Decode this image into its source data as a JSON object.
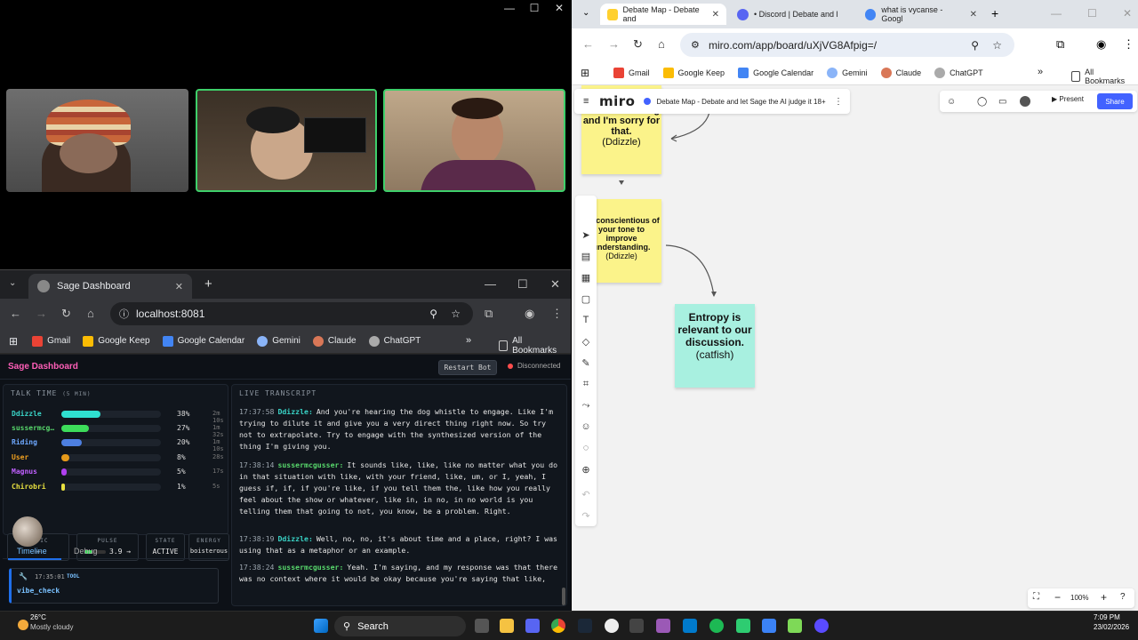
{
  "call": {
    "controls": [
      "—",
      "☐",
      "✕"
    ]
  },
  "sage_browser": {
    "tab_title": "Sage Dashboard",
    "url": "localhost:8081",
    "bookmarks": [
      "Gmail",
      "Google Keep",
      "Google Calendar",
      "Gemini",
      "Claude",
      "ChatGPT"
    ],
    "all_bookmarks": "All Bookmarks",
    "window_controls": [
      "—",
      "☐",
      "✕"
    ]
  },
  "sage": {
    "title": "Sage Dashboard",
    "restart_label": "Restart Bot",
    "status": "Disconnected",
    "talk_time_header": "TALK TIME",
    "talk_time_window": "(5 MIN)",
    "speakers": [
      {
        "name": "Ddizzle",
        "pct": "38%",
        "time": "2m 10s",
        "frac": 0.38,
        "color": "#39d3c6",
        "bar": "#2fe0d0"
      },
      {
        "name": "sussermcg…",
        "pct": "27%",
        "time": "1m 32s",
        "frac": 0.27,
        "color": "#57d66b",
        "bar": "#3ddc5a"
      },
      {
        "name": "Riding",
        "pct": "20%",
        "time": "1m 10s",
        "frac": 0.2,
        "color": "#6ea8ff",
        "bar": "#4d7fe0"
      },
      {
        "name": "User",
        "pct": "8%",
        "time": "28s",
        "frac": 0.08,
        "color": "#f0a020",
        "bar": "#e69a1a"
      },
      {
        "name": "Magnus",
        "pct": "5%",
        "time": "17s",
        "frac": 0.05,
        "color": "#c060ff",
        "bar": "#b040f0"
      },
      {
        "name": "Chirobri",
        "pct": "1%",
        "time": "5s",
        "frac": 0.01,
        "color": "#e8e040",
        "bar": "#e8e040"
      }
    ],
    "stats": [
      {
        "label": "TOPIC",
        "value": "–"
      },
      {
        "label": "PULSE",
        "value": "3.9 →"
      },
      {
        "label": "STATE",
        "value": "ACTIVE"
      },
      {
        "label": "ENERGY",
        "value": "boisterous"
      }
    ],
    "pulse_frac": 0.39,
    "tabs": {
      "timeline": "Timeline",
      "debug": "Debug"
    },
    "timeline_entry": {
      "time": "17:35:01",
      "kind": "TOOL",
      "name": "vibe_check"
    },
    "transcript_header": "LIVE TRANSCRIPT",
    "transcript": [
      {
        "time": "17:37:58",
        "speaker": "Ddizzle:",
        "color": "#39d3c6",
        "text": "And you're hearing the dog whistle to engage. Like I'm trying to dilute it and give you a very direct thing right now. So try not to extrapolate. Try to engage with the synthesized version of the thing I'm giving you."
      },
      {
        "time": "17:38:14",
        "speaker": "sussermcgusser:",
        "color": "#57d66b",
        "text": "It sounds like, like, like no matter what you do in that situation with like, with your friend, like, um, or I, yeah, I guess if, if, if you're like, if you tell them the, like how you really feel about the show or whatever, like in, in no, in no world is you telling them that going to not, you know, be a problem. Right."
      },
      {
        "time": "17:38:19",
        "speaker": "Ddizzle:",
        "color": "#39d3c6",
        "text": "Well, no, no, it's about time and a place, right? I was using that as a metaphor or an example."
      },
      {
        "time": "17:38:24",
        "speaker": "sussermcgusser:",
        "color": "#57d66b",
        "text": "Yeah. I'm saying, and my response was that there was no context where it would be okay because you're saying that like,"
      }
    ]
  },
  "miro_browser": {
    "tabs": [
      {
        "title": "Debate Map - Debate and",
        "fav": "#ffd02f"
      },
      {
        "title": "• Discord | Debate and l",
        "fav": "#5865f2"
      },
      {
        "title": "what is vycanse - Googl",
        "fav": "#4285f4"
      }
    ],
    "url": "miro.com/app/board/uXjVG8Afpig=/",
    "bookmarks": [
      "Gmail",
      "Google Keep",
      "Google Calendar",
      "Gemini",
      "Claude",
      "ChatGPT"
    ],
    "all_bookmarks": "All Bookmarks"
  },
  "miro": {
    "logo": "miro",
    "board_title": "Debate Map - Debate and let Sage the AI judge it 18+",
    "present_label": "Present",
    "share_label": "Share",
    "zoom": "100%",
    "stickies": [
      {
        "text": "I was distracting and I'm sorry for that.",
        "author": "(Ddizzle)"
      },
      {
        "text": "Be conscientious of your tone to improve understanding.",
        "author": "(Ddizzle)"
      },
      {
        "text": "Entropy is relevant to our discussion.",
        "author": "(catfish)"
      }
    ]
  },
  "taskbar": {
    "weather_temp": "26°C",
    "weather_text": "Mostly cloudy",
    "search": "Search",
    "time": "7:09 PM",
    "date": "23/02/2026"
  }
}
